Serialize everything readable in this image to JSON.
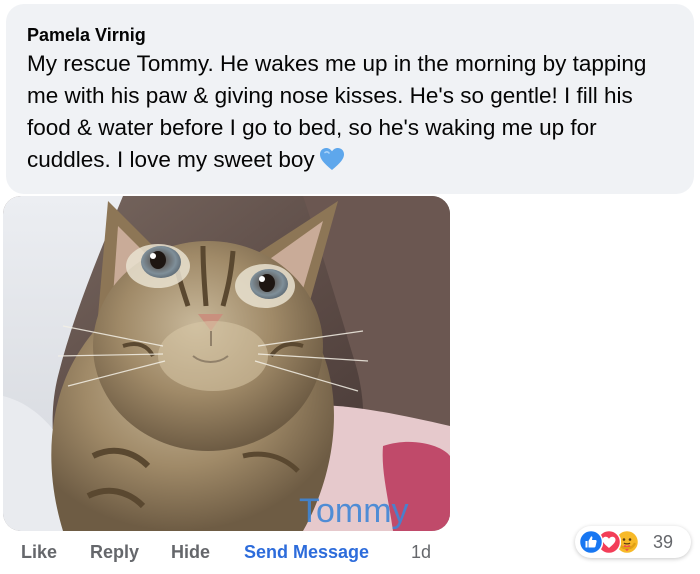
{
  "comment": {
    "author": "Pamela Virnig",
    "text": "My rescue Tommy. He wakes me up in the morning by tapping me with his paw & giving nose kisses. He's so gentle! I fill his food & water before I go to bed, so he's waking me up for cuddles. I love my sweet boy",
    "emoji": "blue-heart-icon"
  },
  "photo": {
    "subject": "tabby-cat-photo",
    "watermark": "Tommy"
  },
  "actions": {
    "like": "Like",
    "reply": "Reply",
    "hide": "Hide",
    "send_message": "Send Message",
    "time": "1d"
  },
  "reactions": {
    "types": [
      "like-icon",
      "love-icon",
      "care-icon"
    ],
    "count": "39"
  },
  "colors": {
    "bubble_bg": "#f0f2f5",
    "link_blue": "#2d6cdb",
    "meta_gray": "#65676b",
    "heart_blue": "#5ea7ec"
  }
}
